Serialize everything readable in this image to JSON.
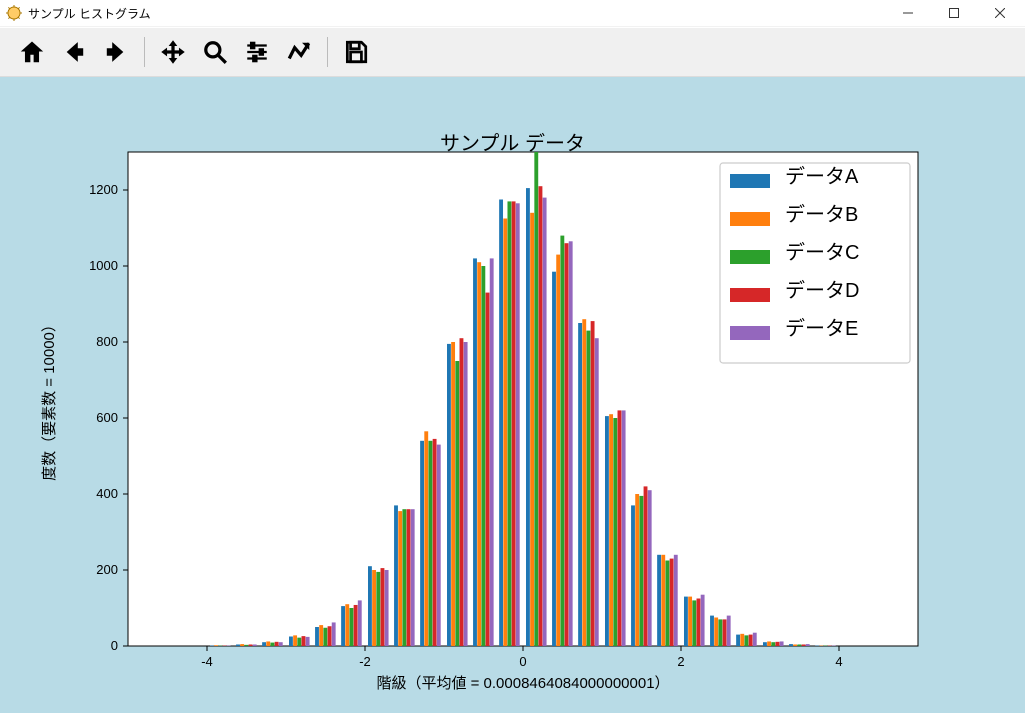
{
  "window": {
    "title": "サンプル ヒストグラム"
  },
  "toolbar": {
    "home": "Home",
    "back": "Back",
    "forward": "Forward",
    "pan": "Pan",
    "zoom": "Zoom",
    "subplots": "Configure subplots",
    "edit": "Edit axis/curve",
    "save": "Save"
  },
  "chart_data": {
    "type": "bar",
    "title": "サンプル データ",
    "xlabel": "階級（平均値 = 0.0008464084000000001）",
    "ylabel": "度数（要素数 = 10000）",
    "xlim": [
      -5.0,
      5.0
    ],
    "ylim": [
      0,
      1300
    ],
    "xticks": [
      -4,
      -2,
      0,
      2,
      4
    ],
    "yticks": [
      0,
      200,
      400,
      600,
      800,
      1000,
      1200
    ],
    "bin_centers": [
      -4.5,
      -4.17,
      -3.83,
      -3.5,
      -3.17,
      -2.83,
      -2.5,
      -2.17,
      -1.83,
      -1.5,
      -1.17,
      -0.83,
      -0.5,
      -0.17,
      0.17,
      0.5,
      0.83,
      1.17,
      1.5,
      1.83,
      2.17,
      2.5,
      2.83,
      3.17,
      3.5,
      3.83,
      4.17,
      4.5
    ],
    "series": [
      {
        "name": "データA",
        "color": "#1f77b4",
        "values": [
          0,
          0,
          1,
          4,
          10,
          25,
          50,
          105,
          210,
          370,
          540,
          795,
          1020,
          1175,
          1205,
          985,
          850,
          605,
          370,
          240,
          130,
          80,
          30,
          10,
          5,
          1,
          0,
          0
        ]
      },
      {
        "name": "データB",
        "color": "#ff7f0e",
        "values": [
          0,
          0,
          2,
          5,
          12,
          28,
          55,
          110,
          200,
          355,
          565,
          800,
          1010,
          1125,
          1140,
          1030,
          860,
          610,
          400,
          240,
          130,
          75,
          32,
          12,
          4,
          1,
          0,
          0
        ]
      },
      {
        "name": "データC",
        "color": "#2ca02c",
        "values": [
          0,
          0,
          1,
          3,
          9,
          22,
          48,
          100,
          195,
          360,
          540,
          750,
          1000,
          1170,
          1300,
          1080,
          830,
          600,
          395,
          225,
          120,
          70,
          28,
          10,
          4,
          1,
          0,
          0
        ]
      },
      {
        "name": "データD",
        "color": "#d62728",
        "values": [
          0,
          0,
          1,
          4,
          11,
          26,
          52,
          108,
          205,
          360,
          545,
          810,
          930,
          1170,
          1210,
          1060,
          855,
          620,
          420,
          230,
          125,
          70,
          30,
          11,
          4,
          1,
          0,
          0
        ]
      },
      {
        "name": "データE",
        "color": "#9467bd",
        "values": [
          0,
          0,
          1,
          4,
          10,
          24,
          62,
          120,
          200,
          360,
          530,
          800,
          1020,
          1165,
          1180,
          1065,
          810,
          620,
          410,
          240,
          135,
          80,
          35,
          12,
          5,
          1,
          0,
          0
        ]
      }
    ],
    "legend": {
      "position": "upper right",
      "items": [
        "データA",
        "データB",
        "データC",
        "データD",
        "データE"
      ],
      "colors": [
        "#1f77b4",
        "#ff7f0e",
        "#2ca02c",
        "#d62728",
        "#9467bd"
      ]
    }
  }
}
